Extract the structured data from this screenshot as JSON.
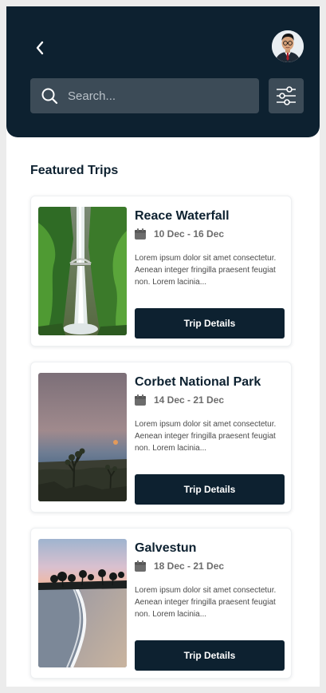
{
  "header": {
    "back_icon": "chevron-left-icon",
    "avatar_icon": "user-avatar",
    "search": {
      "placeholder": "Search...",
      "value": "",
      "icon": "search-icon"
    },
    "filter_icon": "sliders-icon"
  },
  "main": {
    "section_title": "Featured Trips",
    "trips": [
      {
        "title": "Reace Waterfall",
        "date": "10 Dec - 16 Dec",
        "description": "Lorem ipsum dolor sit amet consectetur. Aenean integer fringilla praesent feugiat non. Lorem lacinia...",
        "button_label": "Trip Details"
      },
      {
        "title": "Corbet National Park",
        "date": "14 Dec - 21 Dec",
        "description": "Lorem ipsum dolor sit amet consectetur. Aenean integer fringilla praesent feugiat non. Lorem lacinia...",
        "button_label": "Trip Details"
      },
      {
        "title": "Galvestun",
        "date": "18 Dec - 21 Dec",
        "description": "Lorem ipsum dolor sit amet consectetur. Aenean integer fringilla praesent feugiat non. Lorem lacinia...",
        "button_label": "Trip Details"
      }
    ]
  },
  "colors": {
    "primary_dark": "#0d2130",
    "search_bg": "#3c4b57",
    "background": "#ffffff"
  }
}
